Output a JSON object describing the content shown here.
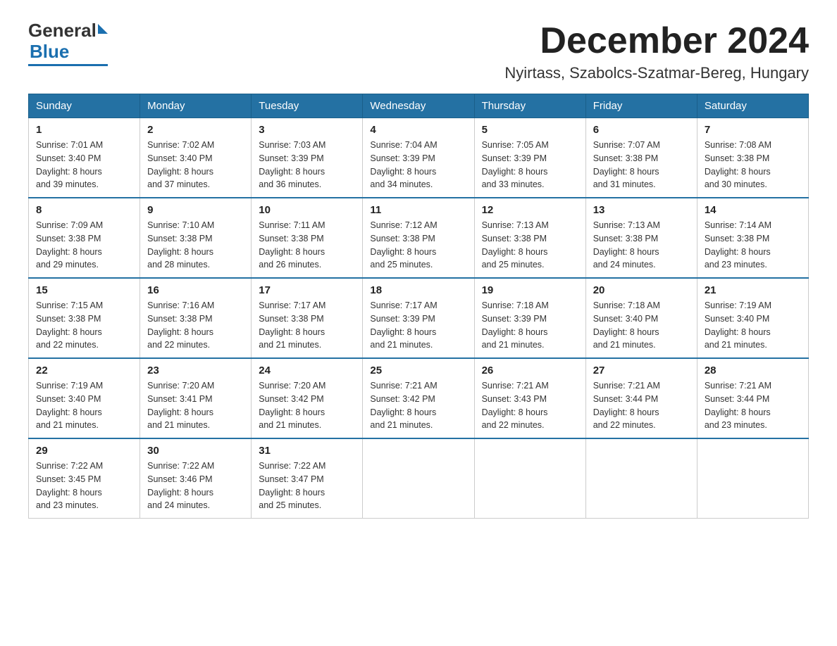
{
  "header": {
    "logo_general": "General",
    "logo_blue": "Blue",
    "title": "December 2024",
    "subtitle": "Nyirtass, Szabolcs-Szatmar-Bereg, Hungary"
  },
  "days_of_week": [
    "Sunday",
    "Monday",
    "Tuesday",
    "Wednesday",
    "Thursday",
    "Friday",
    "Saturday"
  ],
  "weeks": [
    [
      {
        "day": "1",
        "sunrise": "7:01 AM",
        "sunset": "3:40 PM",
        "daylight": "8 hours and 39 minutes."
      },
      {
        "day": "2",
        "sunrise": "7:02 AM",
        "sunset": "3:40 PM",
        "daylight": "8 hours and 37 minutes."
      },
      {
        "day": "3",
        "sunrise": "7:03 AM",
        "sunset": "3:39 PM",
        "daylight": "8 hours and 36 minutes."
      },
      {
        "day": "4",
        "sunrise": "7:04 AM",
        "sunset": "3:39 PM",
        "daylight": "8 hours and 34 minutes."
      },
      {
        "day": "5",
        "sunrise": "7:05 AM",
        "sunset": "3:39 PM",
        "daylight": "8 hours and 33 minutes."
      },
      {
        "day": "6",
        "sunrise": "7:07 AM",
        "sunset": "3:38 PM",
        "daylight": "8 hours and 31 minutes."
      },
      {
        "day": "7",
        "sunrise": "7:08 AM",
        "sunset": "3:38 PM",
        "daylight": "8 hours and 30 minutes."
      }
    ],
    [
      {
        "day": "8",
        "sunrise": "7:09 AM",
        "sunset": "3:38 PM",
        "daylight": "8 hours and 29 minutes."
      },
      {
        "day": "9",
        "sunrise": "7:10 AM",
        "sunset": "3:38 PM",
        "daylight": "8 hours and 28 minutes."
      },
      {
        "day": "10",
        "sunrise": "7:11 AM",
        "sunset": "3:38 PM",
        "daylight": "8 hours and 26 minutes."
      },
      {
        "day": "11",
        "sunrise": "7:12 AM",
        "sunset": "3:38 PM",
        "daylight": "8 hours and 25 minutes."
      },
      {
        "day": "12",
        "sunrise": "7:13 AM",
        "sunset": "3:38 PM",
        "daylight": "8 hours and 25 minutes."
      },
      {
        "day": "13",
        "sunrise": "7:13 AM",
        "sunset": "3:38 PM",
        "daylight": "8 hours and 24 minutes."
      },
      {
        "day": "14",
        "sunrise": "7:14 AM",
        "sunset": "3:38 PM",
        "daylight": "8 hours and 23 minutes."
      }
    ],
    [
      {
        "day": "15",
        "sunrise": "7:15 AM",
        "sunset": "3:38 PM",
        "daylight": "8 hours and 22 minutes."
      },
      {
        "day": "16",
        "sunrise": "7:16 AM",
        "sunset": "3:38 PM",
        "daylight": "8 hours and 22 minutes."
      },
      {
        "day": "17",
        "sunrise": "7:17 AM",
        "sunset": "3:38 PM",
        "daylight": "8 hours and 21 minutes."
      },
      {
        "day": "18",
        "sunrise": "7:17 AM",
        "sunset": "3:39 PM",
        "daylight": "8 hours and 21 minutes."
      },
      {
        "day": "19",
        "sunrise": "7:18 AM",
        "sunset": "3:39 PM",
        "daylight": "8 hours and 21 minutes."
      },
      {
        "day": "20",
        "sunrise": "7:18 AM",
        "sunset": "3:40 PM",
        "daylight": "8 hours and 21 minutes."
      },
      {
        "day": "21",
        "sunrise": "7:19 AM",
        "sunset": "3:40 PM",
        "daylight": "8 hours and 21 minutes."
      }
    ],
    [
      {
        "day": "22",
        "sunrise": "7:19 AM",
        "sunset": "3:40 PM",
        "daylight": "8 hours and 21 minutes."
      },
      {
        "day": "23",
        "sunrise": "7:20 AM",
        "sunset": "3:41 PM",
        "daylight": "8 hours and 21 minutes."
      },
      {
        "day": "24",
        "sunrise": "7:20 AM",
        "sunset": "3:42 PM",
        "daylight": "8 hours and 21 minutes."
      },
      {
        "day": "25",
        "sunrise": "7:21 AM",
        "sunset": "3:42 PM",
        "daylight": "8 hours and 21 minutes."
      },
      {
        "day": "26",
        "sunrise": "7:21 AM",
        "sunset": "3:43 PM",
        "daylight": "8 hours and 22 minutes."
      },
      {
        "day": "27",
        "sunrise": "7:21 AM",
        "sunset": "3:44 PM",
        "daylight": "8 hours and 22 minutes."
      },
      {
        "day": "28",
        "sunrise": "7:21 AM",
        "sunset": "3:44 PM",
        "daylight": "8 hours and 23 minutes."
      }
    ],
    [
      {
        "day": "29",
        "sunrise": "7:22 AM",
        "sunset": "3:45 PM",
        "daylight": "8 hours and 23 minutes."
      },
      {
        "day": "30",
        "sunrise": "7:22 AM",
        "sunset": "3:46 PM",
        "daylight": "8 hours and 24 minutes."
      },
      {
        "day": "31",
        "sunrise": "7:22 AM",
        "sunset": "3:47 PM",
        "daylight": "8 hours and 25 minutes."
      },
      null,
      null,
      null,
      null
    ]
  ],
  "labels": {
    "sunrise": "Sunrise:",
    "sunset": "Sunset:",
    "daylight": "Daylight:"
  }
}
